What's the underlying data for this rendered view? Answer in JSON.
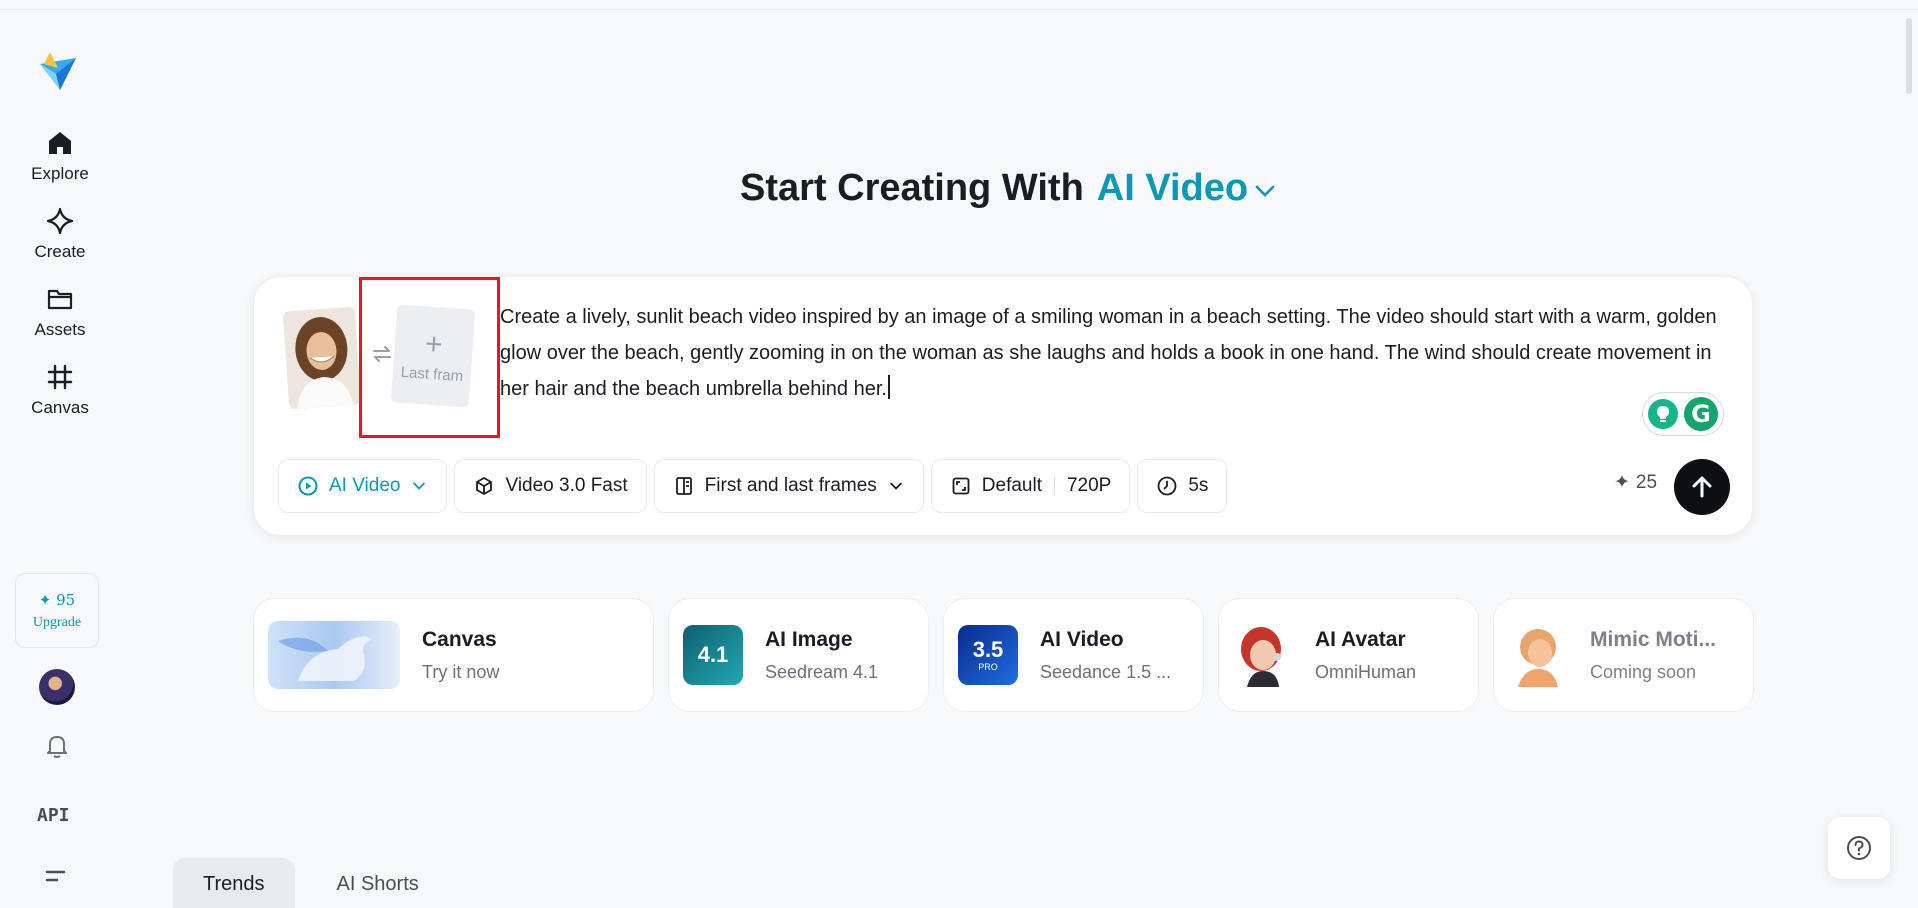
{
  "sidebar": {
    "nav": [
      {
        "label": "Explore",
        "icon": "home-icon"
      },
      {
        "label": "Create",
        "icon": "sparkle-icon"
      },
      {
        "label": "Assets",
        "icon": "folder-icon"
      },
      {
        "label": "Canvas",
        "icon": "frame-icon"
      }
    ],
    "upgrade": {
      "credits": "✦ 95",
      "label": "Upgrade"
    },
    "api_label": "API"
  },
  "heading": {
    "prefix": "Start Creating With",
    "mode": "AI Video"
  },
  "prompt_card": {
    "last_frame_label": "Last fram",
    "last_frame_plus": "+",
    "prompt_text": "Create a lively, sunlit beach video inspired by an image of a smiling woman in a beach setting. The video should start with a warm, golden glow over the beach, gently zooming in on the woman as she laughs and holds a book in one hand. The wind should create movement in her hair and the beach umbrella behind her.",
    "grammarly_letter": "G",
    "toolbar": {
      "mode": "AI Video",
      "model": "Video 3.0 Fast",
      "frames": "First and last frames",
      "ratio": "Default",
      "resolution": "720P",
      "duration": "5s"
    },
    "cost": "25",
    "cost_icon": "✦"
  },
  "features": [
    {
      "title": "Canvas",
      "subtitle": "Try it now"
    },
    {
      "title": "AI Image",
      "subtitle": "Seedream 4.1",
      "badge": "4.1"
    },
    {
      "title": "AI Video",
      "subtitle": "Seedance 1.5 ...",
      "badge": "3.5",
      "badge_sub": "PRO"
    },
    {
      "title": "AI Avatar",
      "subtitle": "OmniHuman"
    },
    {
      "title": "Mimic Moti...",
      "subtitle": "Coming soon"
    }
  ],
  "tabs": [
    {
      "label": "Trends",
      "active": true
    },
    {
      "label": "AI Shorts",
      "active": false
    }
  ],
  "colors": {
    "accent": "#0b98b5",
    "highlight": "#f0131e",
    "send": "#0d0f12"
  }
}
